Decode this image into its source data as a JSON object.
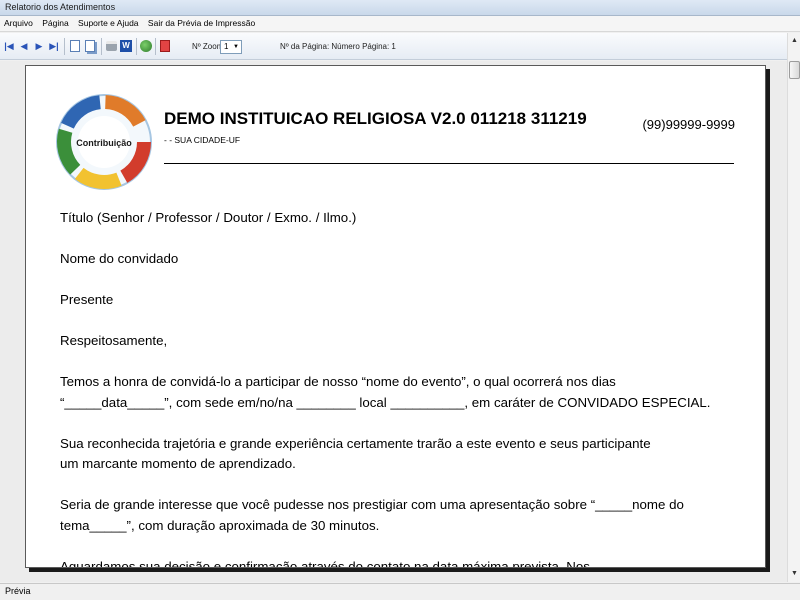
{
  "window": {
    "title": "Relatorio dos Atendimentos"
  },
  "menu": [
    "Arquivo",
    "Página",
    "Suporte e Ajuda",
    "Sair da Prévia de Impressão"
  ],
  "toolbar": {
    "zoom_label": "Nº Zoom",
    "zoom_value": "1",
    "page_label": "Nº da Página: Número Página: 1",
    "icons": [
      "first-page-icon",
      "previous-page-icon",
      "next-page-icon",
      "last-page-icon",
      "single-page-icon",
      "two-pages-icon",
      "print-icon",
      "word-icon",
      "export-icon",
      "pdf-icon"
    ]
  },
  "page": {
    "logo_text": "Contribuição",
    "org_name": "DEMO INSTITUICAO RELIGIOSA V2.0 011218 311219",
    "org_address": "-  - SUA CIDADE-UF",
    "org_phone": "(99)99999-9999",
    "body": [
      [
        "Título (Senhor / Professor / Doutor / Exmo. / Ilmo.)"
      ],
      [
        "Nome do convidado"
      ],
      [
        "Presente"
      ],
      [
        "Respeitosamente,"
      ],
      [
        "Temos a honra de convidá-lo a participar de nosso “nome do evento”, o qual ocorrerá nos dias",
        "“_____data_____”, com sede em/no/na ________ local __________, em caráter de CONVIDADO ESPECIAL."
      ],
      [
        "Sua reconhecida trajetória e grande experiência certamente trarão a este evento e seus participante",
        "um marcante momento de aprendizado."
      ],
      [
        "Seria de grande interesse que você pudesse nos prestigiar com uma apresentação sobre “_____nome do",
        "tema_____”, com duração aproximada de 30 minutos."
      ],
      [
        "Aguardamos sua decisão e confirmação através do contato na data máxima prevista. Nos"
      ]
    ]
  },
  "status": {
    "text": "Prévia"
  },
  "colors": {
    "titlebar": "#c9d8ea",
    "toolbar": "#e6ecf4",
    "page_shadow": "#1a1a1a"
  }
}
